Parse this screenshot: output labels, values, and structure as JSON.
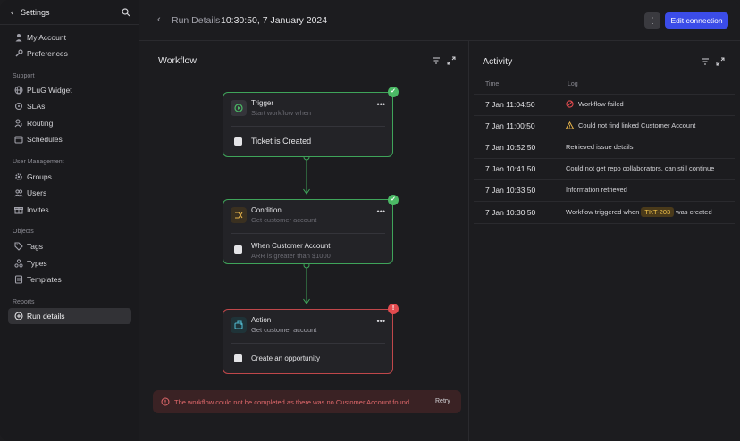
{
  "sidebar": {
    "title": "Settings",
    "items": [
      {
        "label": "My Account",
        "icon": "user-icon"
      },
      {
        "label": "Preferences",
        "icon": "wrench-icon"
      }
    ],
    "sections": [
      {
        "title": "Support",
        "items": [
          {
            "label": "PLuG Widget",
            "icon": "globe-icon"
          },
          {
            "label": "SLAs",
            "icon": "refresh-icon"
          },
          {
            "label": "Routing",
            "icon": "user-route-icon"
          },
          {
            "label": "Schedules",
            "icon": "calendar-icon"
          }
        ]
      },
      {
        "title": "User Management",
        "items": [
          {
            "label": "Groups",
            "icon": "gear-icon"
          },
          {
            "label": "Users",
            "icon": "users-icon"
          },
          {
            "label": "Invites",
            "icon": "gift-icon"
          }
        ]
      },
      {
        "title": "Objects",
        "items": [
          {
            "label": "Tags",
            "icon": "tag-icon"
          },
          {
            "label": "Types",
            "icon": "types-icon"
          },
          {
            "label": "Templates",
            "icon": "layers-icon"
          }
        ]
      },
      {
        "title": "Reports",
        "items": [
          {
            "label": "Run details",
            "icon": "plus-circle-icon",
            "active": true
          }
        ]
      }
    ]
  },
  "header": {
    "breadcrumb": "Run Details",
    "run_time": "10:30:50, 7 January 2024",
    "more_label": "⋮",
    "edit_label": "Edit connection"
  },
  "workflow": {
    "title": "Workflow",
    "nodes": [
      {
        "title": "Trigger",
        "subtitle": "Start workflow when",
        "body": "Ticket is Created",
        "body_sub": "",
        "status": "success"
      },
      {
        "title": "Condition",
        "subtitle": "Get customer account",
        "body": "When Customer Account",
        "body_sub": "ARR is greater than $1000",
        "status": "success"
      },
      {
        "title": "Action",
        "subtitle": "Get customer account",
        "body": "Create an opportunity",
        "body_sub": "",
        "status": "error"
      }
    ],
    "error_message": "The workflow could not be completed as there was no Customer Account found.",
    "retry_label": "Retry"
  },
  "activity": {
    "title": "Activity",
    "col_time": "Time",
    "col_log": "Log",
    "rows": [
      {
        "time": "7 Jan 11:04:50",
        "log": "Workflow failed",
        "icon": "error-icon"
      },
      {
        "time": "7 Jan 11:00:50",
        "log": "Could not find linked Customer Account",
        "icon": "warning-icon"
      },
      {
        "time": "7 Jan 10:52:50",
        "log": "Retrieved issue details",
        "icon": ""
      },
      {
        "time": "7 Jan 10:41:50",
        "log": "Could not get repo collaborators, can still continue",
        "icon": ""
      },
      {
        "time": "7 Jan 10:33:50",
        "log": "Information retrieved",
        "icon": ""
      },
      {
        "time": "7 Jan 10:30:50",
        "log_prefix": "Workflow triggered when",
        "ticket": "TKT-203",
        "log_suffix": "was created",
        "icon": ""
      }
    ]
  },
  "colors": {
    "accent": "#3b4ce8",
    "success": "#4bb965",
    "error": "#e24b4f",
    "ticket": "#f0c24a"
  }
}
